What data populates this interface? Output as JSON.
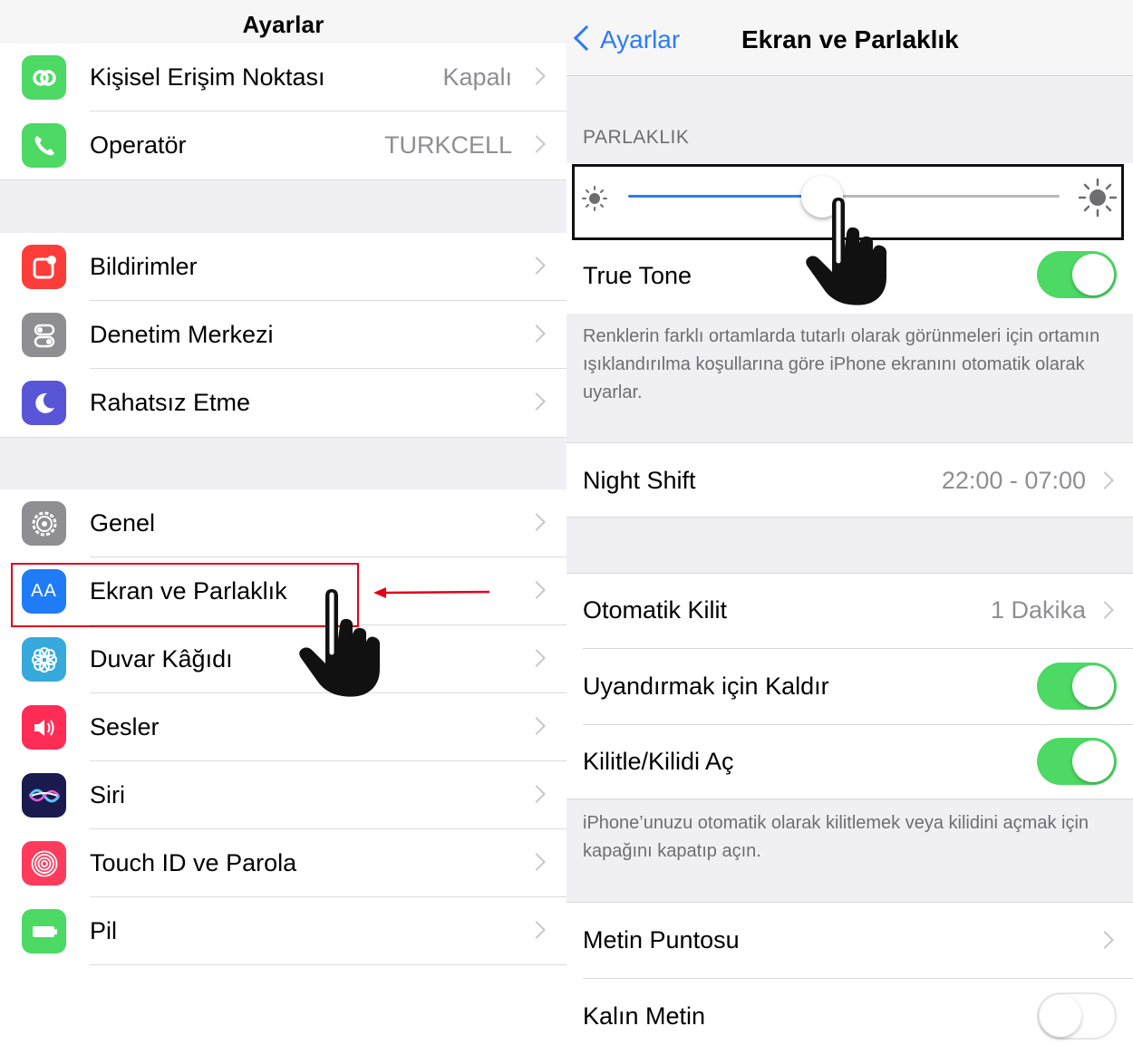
{
  "left": {
    "title": "Ayarlar",
    "groups": [
      [
        {
          "label": "Kişisel Erişim Noktası",
          "value": "Kapalı",
          "icon": "hotspot-icon",
          "color": "#4cd964"
        },
        {
          "label": "Operatör",
          "value": "TURKCELL",
          "icon": "phone-icon",
          "color": "#4cd964"
        }
      ],
      [
        {
          "label": "Bildirimler",
          "icon": "notifications-icon",
          "color": "#fc3d39"
        },
        {
          "label": "Denetim Merkezi",
          "icon": "control-center-icon",
          "color": "#8e8e93"
        },
        {
          "label": "Rahatsız Etme",
          "icon": "moon-icon",
          "color": "#5856d6"
        }
      ],
      [
        {
          "label": "Genel",
          "icon": "gear-icon",
          "color": "#8e8e93"
        },
        {
          "label": "Ekran ve Parlaklık",
          "icon": "display-icon",
          "color": "#1f7cf6",
          "icon_text": "AA"
        },
        {
          "label": "Duvar Kâğıdı",
          "icon": "wallpaper-icon",
          "color": "#36aadc"
        },
        {
          "label": "Sesler",
          "icon": "sound-icon",
          "color": "#ff2d55"
        },
        {
          "label": "Siri",
          "icon": "siri-icon",
          "color": "#1a1a4e"
        },
        {
          "label": "Touch ID ve Parola",
          "icon": "fingerprint-icon",
          "color": "#ff3b5c"
        },
        {
          "label": "Pil",
          "icon": "battery-icon",
          "color": "#4cd964"
        }
      ]
    ]
  },
  "right": {
    "back_label": "Ayarlar",
    "title": "Ekran ve Parlaklık",
    "brightness_section": "PARLAKLIK",
    "brightness_level": 0.45,
    "true_tone": {
      "label": "True Tone",
      "on": true
    },
    "true_tone_footer": "Renklerin farklı ortamlarda tutarlı olarak görünmeleri için ortamın ışıklandırılma koşullarına göre iPhone ekranını otomatik olarak uyarlar.",
    "night_shift": {
      "label": "Night Shift",
      "value": "22:00 - 07:00"
    },
    "auto_lock": {
      "label": "Otomatik Kilit",
      "value": "1 Dakika"
    },
    "raise_to_wake": {
      "label": "Uyandırmak için Kaldır",
      "on": true
    },
    "lock_unlock": {
      "label": "Kilitle/Kilidi Aç",
      "on": true
    },
    "lock_footer": "iPhone’unuzu otomatik olarak kilitlemek veya kilidini açmak için kapağını kapatıp açın.",
    "text_size": {
      "label": "Metin Puntosu"
    },
    "bold_text": {
      "label": "Kalın Metin",
      "on": false
    }
  },
  "colors": {
    "accent": "#2c7cf6",
    "toggle_on": "#4cd964",
    "highlight": "#e3001b"
  }
}
